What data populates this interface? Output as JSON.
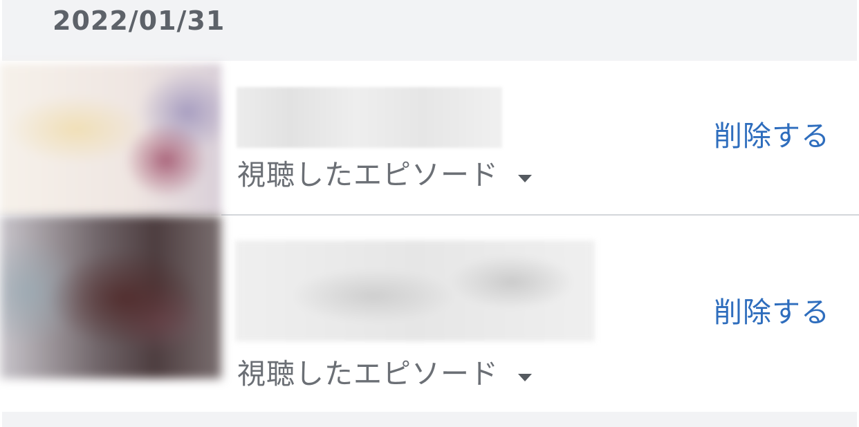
{
  "history": {
    "date": "2022/01/31",
    "items": [
      {
        "episode_label": "視聴したエピソード",
        "delete_label": "削除する"
      },
      {
        "episode_label": "視聴したエピソード",
        "delete_label": "削除する"
      }
    ]
  },
  "colors": {
    "header_bg": "#f2f3f5",
    "date_text": "#5d6269",
    "link": "#2e6dbd",
    "secondary_text": "#6b6f75",
    "divider": "#d3d6da"
  },
  "icons": {
    "dropdown": "caret-down-icon"
  }
}
